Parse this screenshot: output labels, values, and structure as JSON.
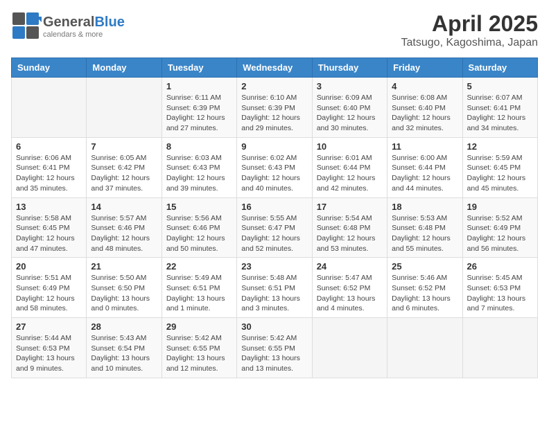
{
  "header": {
    "logo_general": "General",
    "logo_blue": "Blue",
    "month": "April 2025",
    "location": "Tatsugo, Kagoshima, Japan"
  },
  "days_of_week": [
    "Sunday",
    "Monday",
    "Tuesday",
    "Wednesday",
    "Thursday",
    "Friday",
    "Saturday"
  ],
  "weeks": [
    [
      {
        "day": "",
        "info": ""
      },
      {
        "day": "",
        "info": ""
      },
      {
        "day": "1",
        "info": "Sunrise: 6:11 AM\nSunset: 6:39 PM\nDaylight: 12 hours and 27 minutes."
      },
      {
        "day": "2",
        "info": "Sunrise: 6:10 AM\nSunset: 6:39 PM\nDaylight: 12 hours and 29 minutes."
      },
      {
        "day": "3",
        "info": "Sunrise: 6:09 AM\nSunset: 6:40 PM\nDaylight: 12 hours and 30 minutes."
      },
      {
        "day": "4",
        "info": "Sunrise: 6:08 AM\nSunset: 6:40 PM\nDaylight: 12 hours and 32 minutes."
      },
      {
        "day": "5",
        "info": "Sunrise: 6:07 AM\nSunset: 6:41 PM\nDaylight: 12 hours and 34 minutes."
      }
    ],
    [
      {
        "day": "6",
        "info": "Sunrise: 6:06 AM\nSunset: 6:41 PM\nDaylight: 12 hours and 35 minutes."
      },
      {
        "day": "7",
        "info": "Sunrise: 6:05 AM\nSunset: 6:42 PM\nDaylight: 12 hours and 37 minutes."
      },
      {
        "day": "8",
        "info": "Sunrise: 6:03 AM\nSunset: 6:43 PM\nDaylight: 12 hours and 39 minutes."
      },
      {
        "day": "9",
        "info": "Sunrise: 6:02 AM\nSunset: 6:43 PM\nDaylight: 12 hours and 40 minutes."
      },
      {
        "day": "10",
        "info": "Sunrise: 6:01 AM\nSunset: 6:44 PM\nDaylight: 12 hours and 42 minutes."
      },
      {
        "day": "11",
        "info": "Sunrise: 6:00 AM\nSunset: 6:44 PM\nDaylight: 12 hours and 44 minutes."
      },
      {
        "day": "12",
        "info": "Sunrise: 5:59 AM\nSunset: 6:45 PM\nDaylight: 12 hours and 45 minutes."
      }
    ],
    [
      {
        "day": "13",
        "info": "Sunrise: 5:58 AM\nSunset: 6:45 PM\nDaylight: 12 hours and 47 minutes."
      },
      {
        "day": "14",
        "info": "Sunrise: 5:57 AM\nSunset: 6:46 PM\nDaylight: 12 hours and 48 minutes."
      },
      {
        "day": "15",
        "info": "Sunrise: 5:56 AM\nSunset: 6:46 PM\nDaylight: 12 hours and 50 minutes."
      },
      {
        "day": "16",
        "info": "Sunrise: 5:55 AM\nSunset: 6:47 PM\nDaylight: 12 hours and 52 minutes."
      },
      {
        "day": "17",
        "info": "Sunrise: 5:54 AM\nSunset: 6:48 PM\nDaylight: 12 hours and 53 minutes."
      },
      {
        "day": "18",
        "info": "Sunrise: 5:53 AM\nSunset: 6:48 PM\nDaylight: 12 hours and 55 minutes."
      },
      {
        "day": "19",
        "info": "Sunrise: 5:52 AM\nSunset: 6:49 PM\nDaylight: 12 hours and 56 minutes."
      }
    ],
    [
      {
        "day": "20",
        "info": "Sunrise: 5:51 AM\nSunset: 6:49 PM\nDaylight: 12 hours and 58 minutes."
      },
      {
        "day": "21",
        "info": "Sunrise: 5:50 AM\nSunset: 6:50 PM\nDaylight: 13 hours and 0 minutes."
      },
      {
        "day": "22",
        "info": "Sunrise: 5:49 AM\nSunset: 6:51 PM\nDaylight: 13 hours and 1 minute."
      },
      {
        "day": "23",
        "info": "Sunrise: 5:48 AM\nSunset: 6:51 PM\nDaylight: 13 hours and 3 minutes."
      },
      {
        "day": "24",
        "info": "Sunrise: 5:47 AM\nSunset: 6:52 PM\nDaylight: 13 hours and 4 minutes."
      },
      {
        "day": "25",
        "info": "Sunrise: 5:46 AM\nSunset: 6:52 PM\nDaylight: 13 hours and 6 minutes."
      },
      {
        "day": "26",
        "info": "Sunrise: 5:45 AM\nSunset: 6:53 PM\nDaylight: 13 hours and 7 minutes."
      }
    ],
    [
      {
        "day": "27",
        "info": "Sunrise: 5:44 AM\nSunset: 6:53 PM\nDaylight: 13 hours and 9 minutes."
      },
      {
        "day": "28",
        "info": "Sunrise: 5:43 AM\nSunset: 6:54 PM\nDaylight: 13 hours and 10 minutes."
      },
      {
        "day": "29",
        "info": "Sunrise: 5:42 AM\nSunset: 6:55 PM\nDaylight: 13 hours and 12 minutes."
      },
      {
        "day": "30",
        "info": "Sunrise: 5:42 AM\nSunset: 6:55 PM\nDaylight: 13 hours and 13 minutes."
      },
      {
        "day": "",
        "info": ""
      },
      {
        "day": "",
        "info": ""
      },
      {
        "day": "",
        "info": ""
      }
    ]
  ]
}
